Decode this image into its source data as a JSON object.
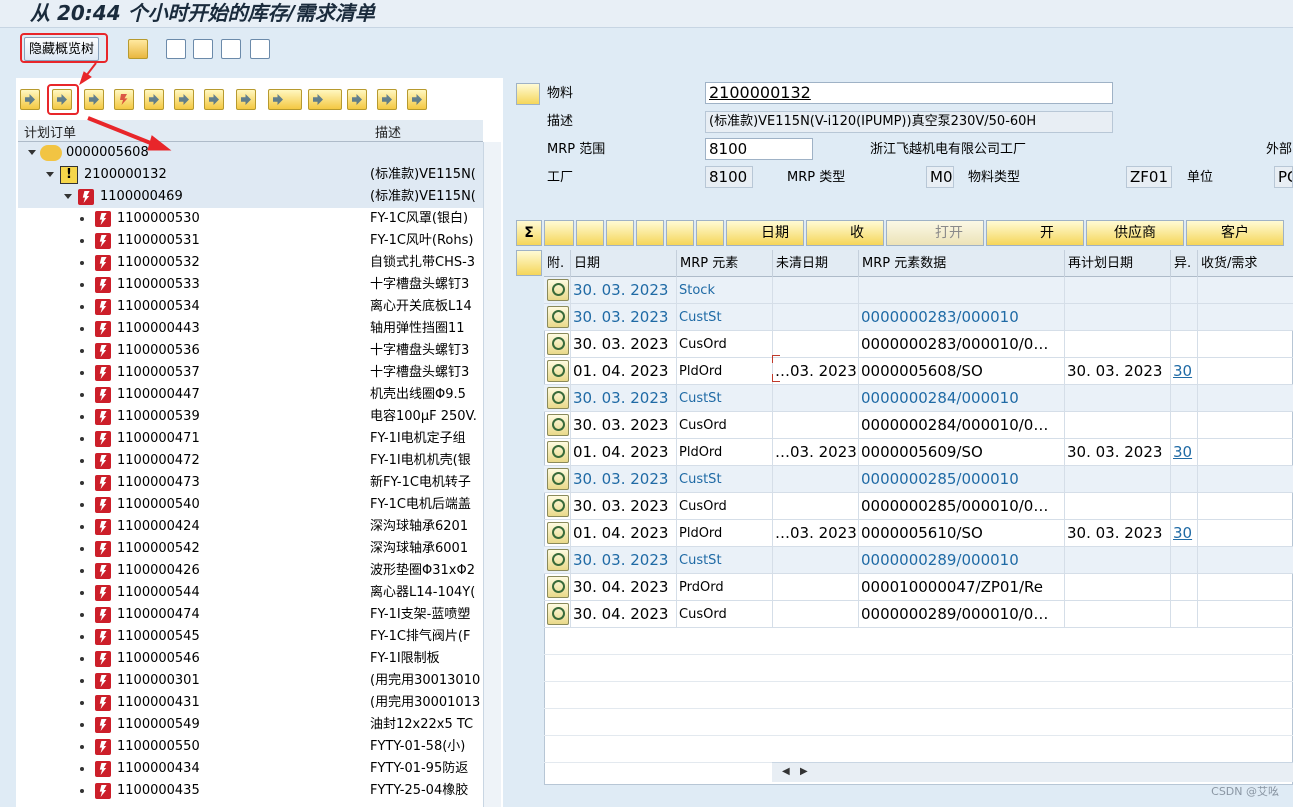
{
  "window": {
    "title": "从 20:44 个小时开始的库存/需求清单"
  },
  "toolbar": {
    "hide_overview_label": "隐藏概览树"
  },
  "tree": {
    "columns": [
      "计划订单",
      "描述"
    ],
    "root": {
      "id": "0000005608"
    },
    "level1": {
      "id": "2100000132",
      "desc": "(标准款)VE115N("
    },
    "level2": {
      "id": "1100000469",
      "desc": "(标准款)VE115N("
    },
    "items": [
      {
        "id": "1100000530",
        "desc": "FY-1C风罩(银白)"
      },
      {
        "id": "1100000531",
        "desc": "FY-1C风叶(Rohs)"
      },
      {
        "id": "1100000532",
        "desc": "自锁式扎带CHS-3"
      },
      {
        "id": "1100000533",
        "desc": "十字槽盘头螺钉3"
      },
      {
        "id": "1100000534",
        "desc": "离心开关底板L14"
      },
      {
        "id": "1100000443",
        "desc": "轴用弹性挡圈11"
      },
      {
        "id": "1100000536",
        "desc": "十字槽盘头螺钉3"
      },
      {
        "id": "1100000537",
        "desc": "十字槽盘头螺钉3"
      },
      {
        "id": "1100000447",
        "desc": "机壳出线圈Φ9.5"
      },
      {
        "id": "1100000539",
        "desc": "电容100μF 250V."
      },
      {
        "id": "1100000471",
        "desc": "FY-1I电机定子组"
      },
      {
        "id": "1100000472",
        "desc": "FY-1I电机机壳(银"
      },
      {
        "id": "1100000473",
        "desc": "新FY-1C电机转子"
      },
      {
        "id": "1100000540",
        "desc": "FY-1C电机后端盖"
      },
      {
        "id": "1100000424",
        "desc": "深沟球轴承6201"
      },
      {
        "id": "1100000542",
        "desc": "深沟球轴承6001"
      },
      {
        "id": "1100000426",
        "desc": "波形垫圈Φ31xΦ2"
      },
      {
        "id": "1100000544",
        "desc": "离心器L14-104Y("
      },
      {
        "id": "1100000474",
        "desc": "FY-1I支架-蓝喷塑"
      },
      {
        "id": "1100000545",
        "desc": "FY-1C排气阀片(F"
      },
      {
        "id": "1100000546",
        "desc": "FY-1I限制板"
      },
      {
        "id": "1100000301",
        "desc": "(用完用30013010"
      },
      {
        "id": "1100000431",
        "desc": "(用完用30001013"
      },
      {
        "id": "1100000549",
        "desc": "油封12x22x5 TC"
      },
      {
        "id": "1100000550",
        "desc": "FYTY-01-58(小)"
      },
      {
        "id": "1100000434",
        "desc": "FYTY-01-95防返"
      },
      {
        "id": "1100000435",
        "desc": "FYTY-25-04橡胶"
      }
    ]
  },
  "header": {
    "material_label": "物料",
    "material": "2100000132",
    "desc_label": "描述",
    "desc": "(标准款)VE115N(V-i120(IPUMP))真空泵230V/50-60H",
    "mrp_area_label": "MRP 范围",
    "mrp_area": "8100",
    "plant_name": "浙江飞越机电有限公司工厂",
    "external_label": "外部",
    "plant_label": "工厂",
    "plant": "8100",
    "mrp_type_label": "MRP 类型",
    "mrp_type": "M0",
    "mat_type_label": "物料类型",
    "mat_type": "ZF01",
    "unit_label": "单位",
    "unit": "PC"
  },
  "buttons": {
    "date": "日期",
    "receipt": "收",
    "open": "打开",
    "open2": "开",
    "vendor": "供应商",
    "customer": "客户"
  },
  "grid": {
    "columns": [
      "附.",
      "日期",
      "MRP 元素",
      "未清日期",
      "MRP 元素数据",
      "再计划日期",
      "异.",
      "收货/需求"
    ],
    "rows": [
      {
        "date": "30. 03. 2023",
        "elem": "Stock",
        "open": "",
        "data": "",
        "replan": "",
        "exc": ""
      },
      {
        "date": "30. 03. 2023",
        "elem": "CustSt",
        "open": "",
        "data": "0000000283/000010",
        "replan": "",
        "exc": ""
      },
      {
        "date": "30. 03. 2023",
        "elem": "CusOrd",
        "open": "",
        "data": "0000000283/000010/0…",
        "replan": "",
        "exc": ""
      },
      {
        "date": "01. 04. 2023",
        "elem": "PldOrd",
        "open": "…03. 2023",
        "data": "0000005608/SO",
        "replan": "30. 03. 2023",
        "exc": "30"
      },
      {
        "date": "30. 03. 2023",
        "elem": "CustSt",
        "open": "",
        "data": "0000000284/000010",
        "replan": "",
        "exc": ""
      },
      {
        "date": "30. 03. 2023",
        "elem": "CusOrd",
        "open": "",
        "data": "0000000284/000010/0…",
        "replan": "",
        "exc": ""
      },
      {
        "date": "01. 04. 2023",
        "elem": "PldOrd",
        "open": "…03. 2023",
        "data": "0000005609/SO",
        "replan": "30. 03. 2023",
        "exc": "30"
      },
      {
        "date": "30. 03. 2023",
        "elem": "CustSt",
        "open": "",
        "data": "0000000285/000010",
        "replan": "",
        "exc": ""
      },
      {
        "date": "30. 03. 2023",
        "elem": "CusOrd",
        "open": "",
        "data": "0000000285/000010/0…",
        "replan": "",
        "exc": ""
      },
      {
        "date": "01. 04. 2023",
        "elem": "PldOrd",
        "open": "…03. 2023",
        "data": "0000005610/SO",
        "replan": "30. 03. 2023",
        "exc": "30"
      },
      {
        "date": "30. 03. 2023",
        "elem": "CustSt",
        "open": "",
        "data": "0000000289/000010",
        "replan": "",
        "exc": ""
      },
      {
        "date": "30. 04. 2023",
        "elem": "PrdOrd",
        "open": "",
        "data": "000010000047/ZP01/Re",
        "replan": "",
        "exc": ""
      },
      {
        "date": "30. 04. 2023",
        "elem": "CusOrd",
        "open": "",
        "data": "0000000289/000010/0…",
        "replan": "",
        "exc": ""
      }
    ]
  },
  "watermark": "CSDN @艾吆"
}
